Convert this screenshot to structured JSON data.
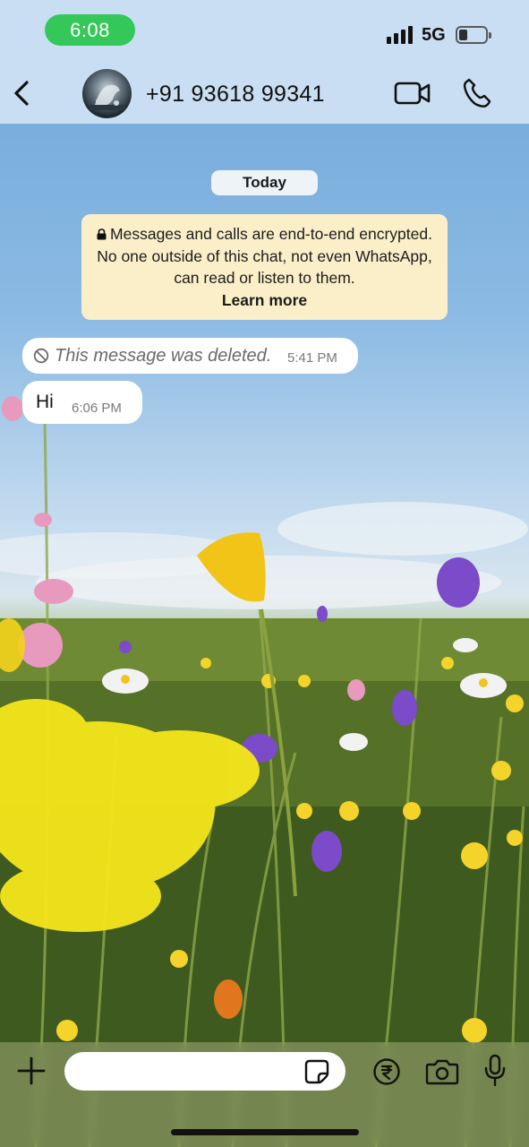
{
  "status_bar": {
    "time": "6:08",
    "network": "5G",
    "signal_bars": 4,
    "battery_level": 0.25,
    "time_pill_color": "#34c759"
  },
  "header": {
    "contact_name": "+91 93618 99341",
    "icons": [
      "chevron-left-icon",
      "video-call-icon",
      "phone-icon"
    ]
  },
  "chat": {
    "date_label": "Today",
    "encryption_notice": {
      "text": "Messages and calls are end-to-end encrypted. No one outside of this chat, not even WhatsApp, can read or listen to them.",
      "link": "Learn more",
      "background": "#fbefc9"
    },
    "messages": [
      {
        "type": "deleted",
        "text": "This message was deleted.",
        "time": "5:41 PM"
      },
      {
        "type": "text",
        "text": "Hi",
        "time": "6:06 PM"
      }
    ]
  },
  "composer": {
    "input_value": "",
    "icons": [
      "plus-icon",
      "sticker-icon",
      "rupee-payment-icon",
      "camera-icon",
      "microphone-icon"
    ]
  }
}
